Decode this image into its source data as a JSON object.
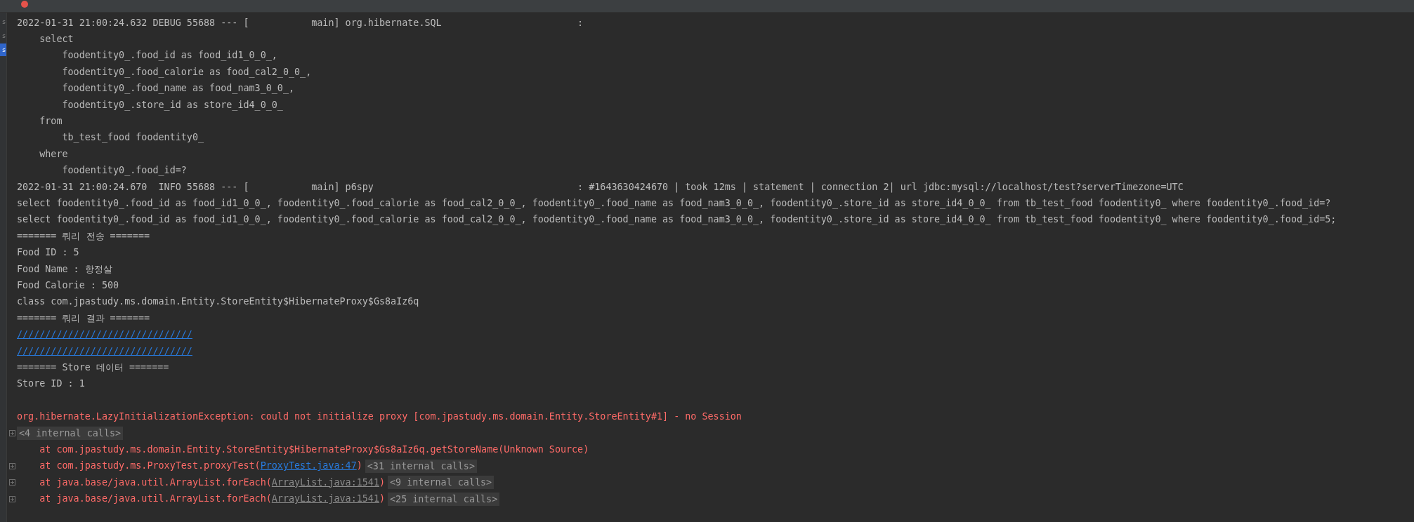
{
  "side_tabs": [
    {
      "label": "s",
      "selected": false
    },
    {
      "label": "s",
      "selected": false
    },
    {
      "label": "s",
      "selected": true
    }
  ],
  "lines": [
    {
      "kind": "plain",
      "text": "2022-01-31 21:00:24.632 DEBUG 55688 --- [           main] org.hibernate.SQL                        :"
    },
    {
      "kind": "plain",
      "text": "    select"
    },
    {
      "kind": "plain",
      "text": "        foodentity0_.food_id as food_id1_0_0_,"
    },
    {
      "kind": "plain",
      "text": "        foodentity0_.food_calorie as food_cal2_0_0_,"
    },
    {
      "kind": "plain",
      "text": "        foodentity0_.food_name as food_nam3_0_0_,"
    },
    {
      "kind": "plain",
      "text": "        foodentity0_.store_id as store_id4_0_0_"
    },
    {
      "kind": "plain",
      "text": "    from"
    },
    {
      "kind": "plain",
      "text": "        tb_test_food foodentity0_"
    },
    {
      "kind": "plain",
      "text": "    where"
    },
    {
      "kind": "plain",
      "text": "        foodentity0_.food_id=?"
    },
    {
      "kind": "plain",
      "text": "2022-01-31 21:00:24.670  INFO 55688 --- [           main] p6spy                                    : #1643630424670 | took 12ms | statement | connection 2| url jdbc:mysql://localhost/test?serverTimezone=UTC"
    },
    {
      "kind": "plain",
      "text": "select foodentity0_.food_id as food_id1_0_0_, foodentity0_.food_calorie as food_cal2_0_0_, foodentity0_.food_name as food_nam3_0_0_, foodentity0_.store_id as store_id4_0_0_ from tb_test_food foodentity0_ where foodentity0_.food_id=?"
    },
    {
      "kind": "plain",
      "text": "select foodentity0_.food_id as food_id1_0_0_, foodentity0_.food_calorie as food_cal2_0_0_, foodentity0_.food_name as food_nam3_0_0_, foodentity0_.store_id as store_id4_0_0_ from tb_test_food foodentity0_ where foodentity0_.food_id=5;"
    },
    {
      "kind": "plain",
      "text": "======= 쿼리 전송 ======="
    },
    {
      "kind": "plain",
      "text": "Food ID : 5"
    },
    {
      "kind": "plain",
      "text": "Food Name : 항정살"
    },
    {
      "kind": "plain",
      "text": "Food Calorie : 500"
    },
    {
      "kind": "plain",
      "text": "class com.jpastudy.ms.domain.Entity.StoreEntity$HibernateProxy$Gs8aIz6q"
    },
    {
      "kind": "plain",
      "text": "======= 쿼리 결과 ======="
    },
    {
      "kind": "slashes",
      "text": "///////////////////////////////"
    },
    {
      "kind": "slashes",
      "text": "///////////////////////////////"
    },
    {
      "kind": "plain",
      "text": "======= Store 데이터 ======="
    },
    {
      "kind": "plain",
      "text": "Store ID : 1"
    },
    {
      "kind": "blank"
    },
    {
      "kind": "error",
      "text": "org.hibernate.LazyInitializationException: could not initialize proxy [com.jpastudy.ms.domain.Entity.StoreEntity#1] - no Session"
    },
    {
      "kind": "fold",
      "folded": "<4 internal calls>"
    },
    {
      "kind": "error",
      "text": "    at com.jpastudy.ms.domain.Entity.StoreEntity$HibernateProxy$Gs8aIz6q.getStoreName(Unknown Source)"
    },
    {
      "kind": "stack",
      "text": "    at com.jpastudy.ms.ProxyTest.proxyTest(",
      "link": "ProxyTest.java:47",
      "in_project": true,
      "after": ")",
      "folded": "<31 internal calls>"
    },
    {
      "kind": "stack",
      "text": "    at java.base/java.util.ArrayList.forEach(",
      "link": "ArrayList.java:1541",
      "in_project": false,
      "after": ")",
      "folded": "<9 internal calls>"
    },
    {
      "kind": "stack",
      "text": "    at java.base/java.util.ArrayList.forEach(",
      "link": "ArrayList.java:1541",
      "in_project": false,
      "after": ")",
      "folded": "<25 internal calls>"
    }
  ]
}
